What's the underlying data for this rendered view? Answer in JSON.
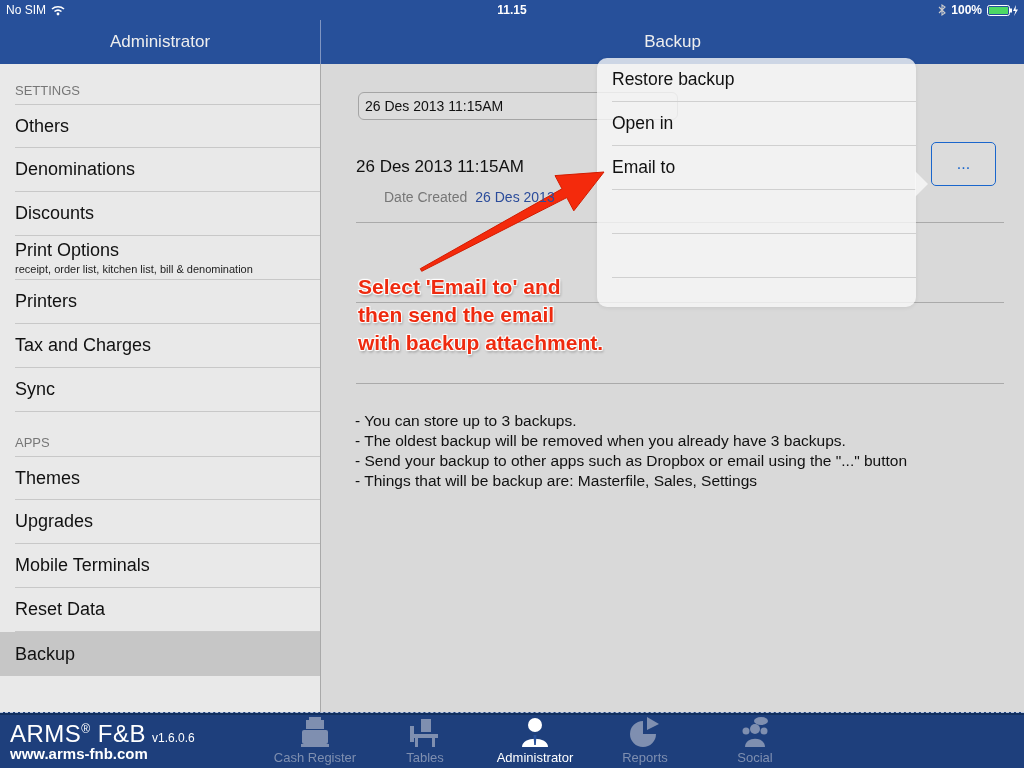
{
  "status_bar": {
    "carrier": "No SIM",
    "time": "11.15",
    "battery": "100%"
  },
  "sidebar": {
    "title": "Administrator",
    "sections": [
      {
        "header": "SETTINGS",
        "items": [
          {
            "label": "Others",
            "selected": false
          },
          {
            "label": "Denominations",
            "selected": false
          },
          {
            "label": "Discounts",
            "selected": false
          },
          {
            "label": "Print Options",
            "subtitle": "receipt, order list, kitchen list, bill & denomination",
            "selected": false
          },
          {
            "label": "Printers",
            "selected": false
          },
          {
            "label": "Tax and Charges",
            "selected": false
          },
          {
            "label": "Sync",
            "selected": false
          }
        ]
      },
      {
        "header": "APPS",
        "items": [
          {
            "label": "Themes",
            "selected": false
          },
          {
            "label": "Upgrades",
            "selected": false
          },
          {
            "label": "Mobile Terminals",
            "selected": false
          },
          {
            "label": "Reset Data",
            "selected": false
          },
          {
            "label": "Backup",
            "selected": true
          }
        ]
      }
    ]
  },
  "main": {
    "title": "Backup",
    "name_field": {
      "value": "26 Des 2013 11:15AM"
    },
    "backups": [
      {
        "name": "26 Des 2013 11:15AM",
        "date_label": "Date Created",
        "date_value": "26 Des 2013",
        "more_button": "..."
      }
    ],
    "notes": [
      "- You can store up to 3 backups.",
      "- The oldest backup will be removed when you already have 3 backups.",
      "- Send your backup to other apps such as Dropbox or email using the \"...\" button",
      "- Things that will be backup are: Masterfile, Sales, Settings"
    ]
  },
  "popover": {
    "items": [
      {
        "label": "Restore backup"
      },
      {
        "label": "Open in"
      },
      {
        "label": "Email to"
      }
    ]
  },
  "annotation": {
    "text": "Select 'Email to' and\nthen send the email\nwith backup attachment."
  },
  "tab_bar": {
    "brand": "ARMS$^{®}$ F&B",
    "version": "v1.6.0.6",
    "website": "www.arms-fnb.com",
    "tabs": [
      {
        "kind": "register",
        "label": "Cash Register",
        "selected": false
      },
      {
        "kind": "tables",
        "label": "Tables",
        "selected": false
      },
      {
        "kind": "admin",
        "label": "Administrator",
        "selected": true
      },
      {
        "kind": "reports",
        "label": "Reports",
        "selected": false
      },
      {
        "kind": "social",
        "label": "Social",
        "selected": false
      }
    ]
  }
}
